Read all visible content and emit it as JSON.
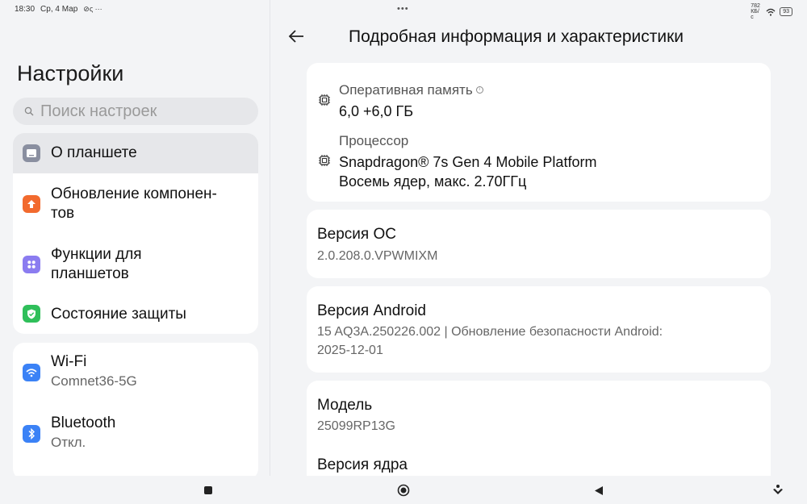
{
  "status": {
    "time": "18:30",
    "date": "Ср, 4 Мар",
    "net_speed": "782 КБ/с",
    "battery": "93"
  },
  "sidebar": {
    "title": "Настройки",
    "search_placeholder": "Поиск настроек",
    "group1": [
      {
        "label": "О планшете",
        "icon": "tablet-icon",
        "color": "#8a8fa0"
      },
      {
        "label": "Обновление компонен-",
        "label2": "тов",
        "icon": "update-arrow-icon",
        "color": "#f26a2e"
      },
      {
        "label": "Функции для",
        "label2": "планшетов",
        "icon": "apps-grid-icon",
        "color": "#8b7cf0"
      },
      {
        "label": "Состояние защиты",
        "icon": "shield-check-icon",
        "color": "#2fbf5a"
      }
    ],
    "group2": [
      {
        "label": "Wi-Fi",
        "sub": "Comnet36-5G",
        "icon": "wifi-icon",
        "color": "#3b82f6"
      },
      {
        "label": "Bluetooth",
        "sub": "Откл.",
        "icon": "bluetooth-icon",
        "color": "#3b82f6"
      }
    ]
  },
  "main": {
    "title": "Подробная информация и характеристики",
    "ram_label": "Оперативная память",
    "ram_value": "6,0 +6,0 ГБ",
    "cpu_label": "Процессор",
    "cpu_value1": "Snapdragon® 7s Gen 4 Mobile Platform",
    "cpu_value2": "Восемь ядер, макс. 2.70ГГц",
    "os_label": "Версия ОС",
    "os_value": "2.0.208.0.VPWMIXM",
    "android_label": "Версия Android",
    "android_value1": "15 AQ3A.250226.002 | Обновление безопасности Android:",
    "android_value2": "2025-12-01",
    "model_label": "Модель",
    "model_value": "25099RP13G",
    "kernel_label": "Версия ядра"
  }
}
